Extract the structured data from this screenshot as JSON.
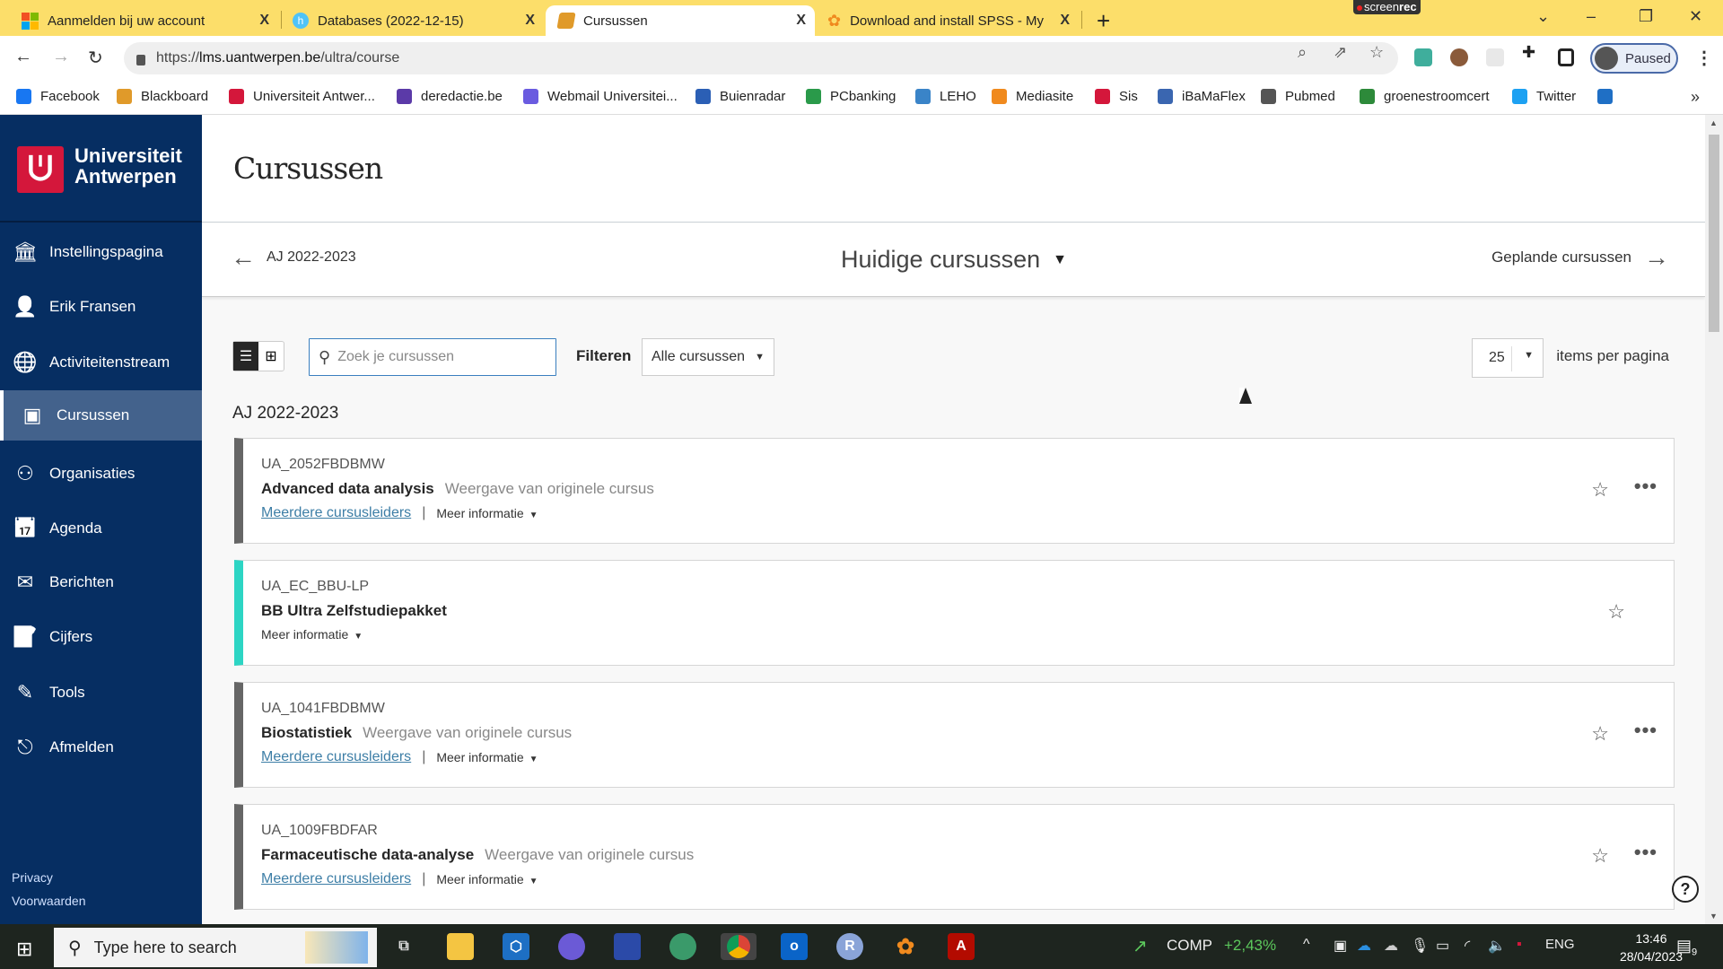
{
  "browser": {
    "tabs": [
      {
        "title": "Aanmelden bij uw account",
        "icon": "microsoft-icon",
        "active": false
      },
      {
        "title": "Databases (2022-12-15)",
        "icon": "h-icon",
        "active": false
      },
      {
        "title": "Cursussen",
        "icon": "blackboard-icon",
        "active": true
      },
      {
        "title": "Download and install SPSS - My I",
        "icon": "mediasite-icon",
        "active": false
      }
    ],
    "new_tab_label": "+",
    "close_label": "X",
    "screenrec_label": "screen",
    "screenrec_bold": "rec",
    "url_prefix": "https://",
    "url_host": "lms.uantwerpen.be",
    "url_path": "/ultra/course",
    "profile_label": "Paused",
    "bookmarks": [
      {
        "label": "Facebook",
        "color": "#1877f2"
      },
      {
        "label": "Blackboard",
        "color": "#e09a2a"
      },
      {
        "label": "Universiteit Antwer...",
        "color": "#d4173b"
      },
      {
        "label": "deredactie.be",
        "color": "#5b3aa8"
      },
      {
        "label": "Webmail Universitei...",
        "color": "#6a5be0"
      },
      {
        "label": "Buienradar",
        "color": "#2b5fb5"
      },
      {
        "label": "PCbanking",
        "color": "#2a9a4a"
      },
      {
        "label": "LEHO",
        "color": "#3a84c8"
      },
      {
        "label": "Mediasite",
        "color": "#f08a1e"
      },
      {
        "label": "Sis",
        "color": "#d4173b"
      },
      {
        "label": "iBaMaFlex",
        "color": "#3a66b0"
      },
      {
        "label": "Pubmed",
        "color": "#555555"
      },
      {
        "label": "groenestroomcert",
        "color": "#2d8a3a"
      },
      {
        "label": "Twitter",
        "color": "#1da1f2"
      },
      {
        "label": "",
        "color": "#1f6fc5"
      }
    ],
    "bookmarks_more": "»"
  },
  "sidebar": {
    "logo_line1": "Universiteit",
    "logo_line2": "Antwerpen",
    "items": [
      {
        "label": "Instellingspagina",
        "icon": "institution-icon"
      },
      {
        "label": "Erik Fransen",
        "icon": "user-icon"
      },
      {
        "label": "Activiteitenstream",
        "icon": "globe-icon"
      },
      {
        "label": "Cursussen",
        "icon": "courses-icon",
        "active": true
      },
      {
        "label": "Organisaties",
        "icon": "organizations-icon"
      },
      {
        "label": "Agenda",
        "icon": "calendar-icon"
      },
      {
        "label": "Berichten",
        "icon": "envelope-icon"
      },
      {
        "label": "Cijfers",
        "icon": "grades-icon"
      },
      {
        "label": "Tools",
        "icon": "tools-icon"
      },
      {
        "label": "Afmelden",
        "icon": "logout-icon"
      }
    ],
    "footer": {
      "privacy": "Privacy",
      "terms": "Voorwaarden"
    }
  },
  "main": {
    "title": "Cursussen",
    "term_prev": "AJ 2022-2023",
    "term_current": "Huidige cursussen",
    "term_next": "Geplande cursussen",
    "search_placeholder": "Zoek je cursussen",
    "filter_label": "Filteren",
    "filter_value": "Alle cursussen",
    "per_page_value": "25",
    "per_page_label": "items per pagina",
    "term_heading": "AJ 2022-2023",
    "courses": [
      {
        "code": "UA_2052FBDBMW",
        "title": "Advanced data analysis",
        "subtitle": "Weergave van originele cursus",
        "leaders": "Meerdere cursusleiders",
        "more": "Meer informatie",
        "accent": "#666666",
        "has_menu": true
      },
      {
        "code": "UA_EC_BBU-LP",
        "title": "BB Ultra Zelfstudiepakket",
        "subtitle": "",
        "leaders": "",
        "more": "Meer informatie",
        "accent": "#2dd5c4",
        "has_menu": false
      },
      {
        "code": "UA_1041FBDBMW",
        "title": "Biostatistiek",
        "subtitle": "Weergave van originele cursus",
        "leaders": "Meerdere cursusleiders",
        "more": "Meer informatie",
        "accent": "#666666",
        "has_menu": true
      },
      {
        "code": "UA_1009FBDFAR",
        "title": "Farmaceutische data-analyse",
        "subtitle": "Weergave van originele cursus",
        "leaders": "Meerdere cursusleiders",
        "more": "Meer informatie",
        "accent": "#666666",
        "has_menu": true
      }
    ]
  },
  "taskbar": {
    "search_placeholder": "Type here to search",
    "stock_label": "COMP",
    "stock_change": "+2,43%",
    "language": "ENG",
    "time": "13:46",
    "date": "28/04/2023",
    "notifications": "9"
  }
}
